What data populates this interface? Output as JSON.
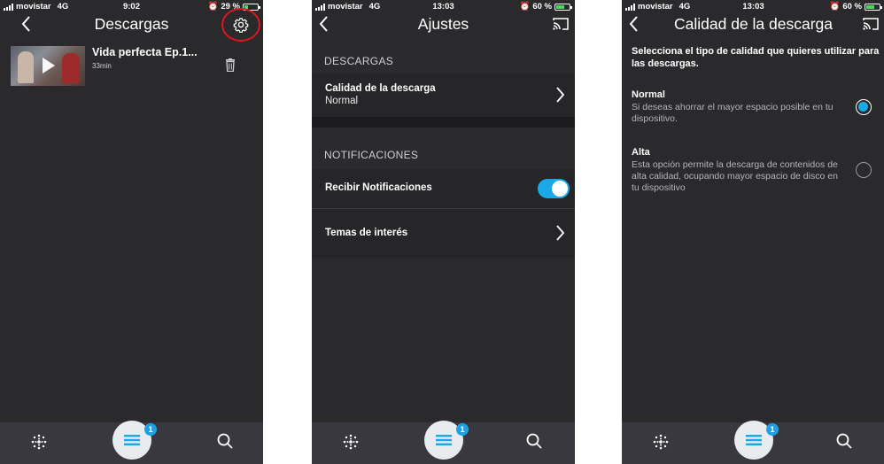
{
  "accent_color": "#1aa9e8",
  "highlight_color": "#e0151c",
  "screens": [
    {
      "status": {
        "carrier": "movistar",
        "network": "4G",
        "time": "9:02",
        "battery": "29 %"
      },
      "title": "Descargas",
      "downloads": [
        {
          "title": "Vida perfecta Ep.1...",
          "duration": "33min"
        }
      ],
      "tabbar": {
        "badge": "1"
      },
      "icons": [
        "back-icon",
        "gear-icon",
        "trash-icon",
        "play-icon",
        "home-dots-icon",
        "menu-icon",
        "search-icon"
      ]
    },
    {
      "status": {
        "carrier": "movistar",
        "network": "4G",
        "time": "13:03",
        "battery": "60 %"
      },
      "title": "Ajustes",
      "sections": [
        {
          "header": "DESCARGAS",
          "rows": [
            {
              "title": "Calidad de la descarga",
              "value": "Normal"
            }
          ]
        },
        {
          "header": "NOTIFICACIONES",
          "rows": [
            {
              "title": "Recibir Notificaciones",
              "toggle": true
            },
            {
              "title": "Temas de interés"
            }
          ]
        }
      ],
      "tabbar": {
        "badge": "1"
      }
    },
    {
      "status": {
        "carrier": "movistar",
        "network": "4G",
        "time": "13:03",
        "battery": "60 %"
      },
      "title": "Calidad de la descarga",
      "intro": "Selecciona el tipo de calidad que quieres utilizar para las descargas.",
      "options": [
        {
          "title": "Normal",
          "description": "Si deseas ahorrar el mayor espacio posible en tu dispositivo.",
          "selected": true
        },
        {
          "title": "Alta",
          "description": "Esta opción permite la descarga de contenidos de alta calidad, ocupando mayor espacio de disco en tu dispositivo",
          "selected": false
        }
      ],
      "tabbar": {
        "badge": "1"
      }
    }
  ]
}
